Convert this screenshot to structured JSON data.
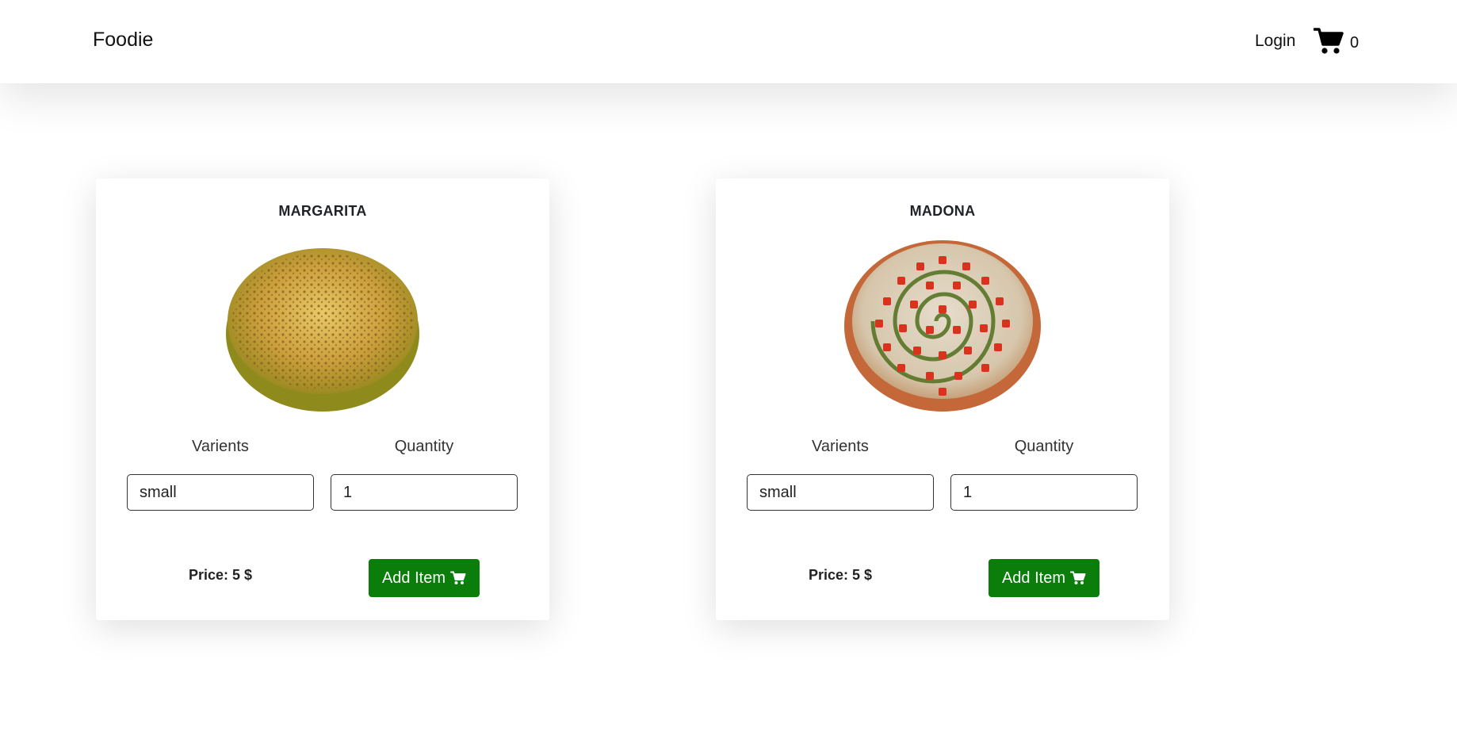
{
  "navbar": {
    "brand": "Foodie",
    "login_label": "Login",
    "cart_icon": "shopping-cart-icon",
    "cart_count": "0"
  },
  "products": [
    {
      "name": "MARGARITA",
      "image_icon": "pizza-margarita-image",
      "variants_label": "Varients",
      "variant_value": "small",
      "quantity_label": "Quantity",
      "quantity_value": "1",
      "price_text": "Price: 5 $",
      "add_label": "Add Item"
    },
    {
      "name": "MADONA",
      "image_icon": "pizza-madona-image",
      "variants_label": "Varients",
      "variant_value": "small",
      "quantity_label": "Quantity",
      "quantity_value": "1",
      "price_text": "Price: 5 $",
      "add_label": "Add Item"
    }
  ],
  "colors": {
    "button": "#0a7d0a",
    "text": "#212529"
  }
}
